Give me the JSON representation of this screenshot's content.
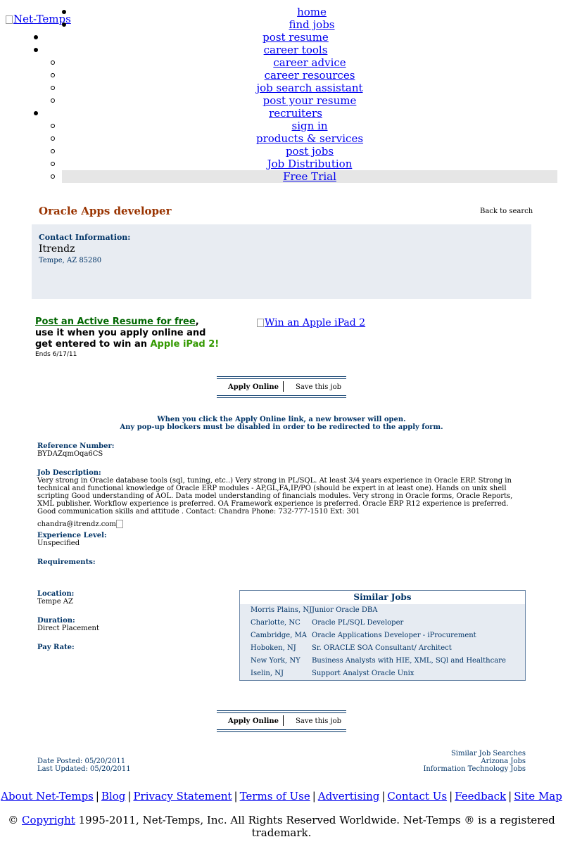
{
  "header": {
    "logo_alt": "Net-Temps"
  },
  "nav": {
    "home": "home",
    "find_jobs": "find jobs",
    "post_resume": "post resume",
    "career_tools": "career tools",
    "career_tools_items": [
      "career advice",
      "career resources",
      "job search assistant",
      "post your resume"
    ],
    "recruiters": "recruiters",
    "recruiters_items": [
      "sign in",
      "products & services",
      "post jobs",
      "Job Distribution",
      "Free Trial"
    ]
  },
  "job": {
    "title": "Oracle Apps developer",
    "back_link": "Back to search",
    "contact_label": "Contact Information:",
    "company": "Itrendz",
    "company_location": "Tempe, AZ 85280"
  },
  "promo": {
    "link_text": "Post an Active Resume for free",
    "after_link": ",",
    "line2": "use it when you apply online and",
    "line3_prefix": "get entered to win an ",
    "line3_highlight": "Apple iPad 2!",
    "ends": "Ends 6/17/11",
    "ipad_alt": "Win an Apple iPad 2"
  },
  "actions": {
    "apply_label": "Apply Online",
    "save_label": "Save this job"
  },
  "popup_note": {
    "line1": "When you click the Apply Online link, a new browser will open.",
    "line2": "Any pop-up blockers must be disabled in order to be redirected to the apply form."
  },
  "details": {
    "reference_label": "Reference Number:",
    "reference_value": "BYDAZqmOqa6CS",
    "description_label": "Job Description:",
    "description": "Very strong in Oracle database tools (sql, tuning, etc..) Very strong in PL/SQL. At least 3/4 years experience in Oracle ERP. Strong in technical and functional knowledge of Oracle ERP modules - AP,GL,FA,IP/PO (should be expert in at least one). Hands on unix shell scripting Good understanding of AOL. Data model understanding of financials modules. Very strong in Oracle forms, Oracle Reports, XML publisher. Workflow experience is preferred. OA Framework experience is preferred. Oracle ERP R12 experience is preferred. Good communication skills and attitude . Contact: Chandra Phone: 732-777-1510 Ext: 301",
    "description_email": "chandra@itrendz.com",
    "experience_label": "Experience Level:",
    "experience_value": "Unspecified",
    "requirements_label": "Requirements:",
    "location_label": "Location:",
    "location_value": "Tempe AZ",
    "duration_label": "Duration:",
    "duration_value": "Direct Placement",
    "pay_label": "Pay Rate:"
  },
  "similar_jobs": {
    "heading": "Similar Jobs",
    "rows": [
      {
        "location": "Morris Plains, NJ",
        "title": "Junior Oracle DBA"
      },
      {
        "location": "Charlotte, NC",
        "title": "Oracle PL/SQL Developer"
      },
      {
        "location": "Cambridge, MA",
        "title": "Oracle Applications Developer - iProcurement"
      },
      {
        "location": "Hoboken, NJ",
        "title": "Sr. ORACLE SOA Consultant/ Architect"
      },
      {
        "location": "New York, NY",
        "title": "Business Analysts with HIE, XML, SQl and Healthcare"
      },
      {
        "location": "Iselin, NJ",
        "title": "Support Analyst Oracle Unix"
      }
    ]
  },
  "dates": {
    "posted": "Date Posted: 05/20/2011",
    "updated": "Last Updated: 05/20/2011"
  },
  "similar_searches": {
    "heading": "Similar Job Searches",
    "items": [
      "Arizona Jobs",
      "Information Technology Jobs"
    ]
  },
  "footer": {
    "links": [
      "About Net-Temps",
      "Blog",
      "Privacy Statement",
      "Terms of Use",
      "Advertising",
      "Contact Us",
      "Feedback",
      "Site Map"
    ],
    "copyright_symbol": "©",
    "copyright_link": "Copyright",
    "copyright_text": " 1995-2011, Net-Temps, Inc. All Rights Reserved Worldwide. Net-Temps ® is a registered trademark."
  }
}
